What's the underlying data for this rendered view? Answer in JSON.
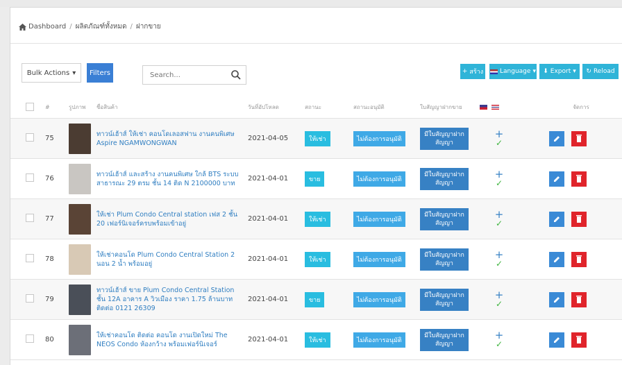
{
  "breadcrumb": [
    "Dashboard",
    "ผลิตภัณฑ์ทั้งหมด",
    "ฝากขาย"
  ],
  "toolbar": {
    "bulk_label": "Bulk Actions",
    "filters_label": "Filters",
    "search_placeholder": "Search...",
    "add_label": "สร้าง",
    "language_label": "Language",
    "export_label": "Export",
    "reload_label": "Reload"
  },
  "table": {
    "headers": [
      "#",
      "รูปภาพ",
      "ชื่อสินค้า",
      "วันที่อัปโหลด",
      "สถานะ",
      "สถานะอนุมัติ",
      "ใบสัญญาฝากขาย",
      "",
      "จัดการ"
    ],
    "rows": [
      {
        "id": "75",
        "name": "ทาวน์เฮ้าส์ ให้เช่า คอนโดเลอสฟาน งานคนพิเศษ Aspire NGAMWONGWAN",
        "date": "2021-04-05",
        "status": "ให้เช่า",
        "approval": "ไม่ต้องการอนุมัติ",
        "contract": "มีใบสัญญาฝาก สัญญา",
        "thumb": "#4b3c32"
      },
      {
        "id": "76",
        "name": "ทาวน์เฮ้าส์ และสร้าง งานคนพิเศษ ใกล้ BTS ระบบสาธารณะ 29 ตรม ชั้น 14 ติด N 2100000 บาท",
        "date": "2021-04-01",
        "status": "ขาย",
        "approval": "ไม่ต้องการอนุมัติ",
        "contract": "มีใบสัญญาฝาก สัญญา",
        "thumb": "#c9c6c2"
      },
      {
        "id": "77",
        "name": "ให้เช่า Plum Condo Central station เฟส 2 ชั้น 20 เฟอร์นิเจอร์ครบพร้อมเข้าอยู่",
        "date": "2021-04-01",
        "status": "ให้เช่า",
        "approval": "ไม่ต้องการอนุมัติ",
        "contract": "มีใบสัญญาฝาก สัญญา",
        "thumb": "#5a4436"
      },
      {
        "id": "78",
        "name": "ให้เช่าคอนโด Plum Condo Central Station 2 นอน 2 น้ำ พร้อมอยู่",
        "date": "2021-04-01",
        "status": "ให้เช่า",
        "approval": "ไม่ต้องการอนุมัติ",
        "contract": "มีใบสัญญาฝาก สัญญา",
        "thumb": "#d8c9b5"
      },
      {
        "id": "79",
        "name": "ทาวน์เฮ้าส์ ขาย Plum Condo Central Station ชั้น 12A อาคาร A วิวเมือง ราคา 1.75 ล้านบาท ติดต่อ 0121 26309",
        "date": "2021-04-01",
        "status": "ขาย",
        "approval": "ไม่ต้องการอนุมัติ",
        "contract": "มีใบสัญญาฝาก สัญญา",
        "thumb": "#4a4f58"
      },
      {
        "id": "80",
        "name": "ให้เช่าคอนโด ติดต่อ คอนโด งานเปิดใหม่ The NEOS Condo ห้องกว้าง พร้อมเฟอร์นิเจอร์",
        "date": "2021-04-01",
        "status": "ให้เช่า",
        "approval": "ไม่ต้องการอนุมัติ",
        "contract": "มีใบสัญญาฝาก สัญญา",
        "thumb": "#6c6f78"
      }
    ]
  }
}
